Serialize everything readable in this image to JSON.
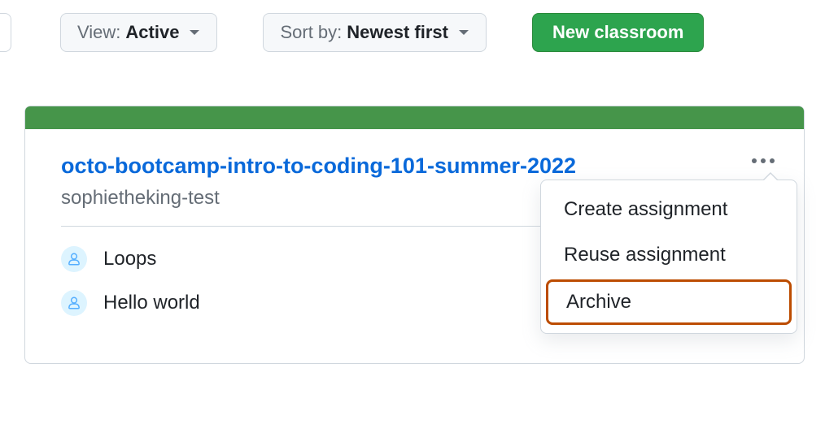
{
  "toolbar": {
    "view": {
      "prefix": "View:",
      "value": "Active"
    },
    "sort": {
      "prefix": "Sort by:",
      "value": "Newest first"
    },
    "new_classroom_label": "New classroom"
  },
  "classroom": {
    "title": "octo-bootcamp-intro-to-coding-101-summer-2022",
    "subtitle": "sophietheking-test",
    "assignments": [
      {
        "name": "Loops"
      },
      {
        "name": "Hello world"
      }
    ],
    "menu": {
      "create": "Create assignment",
      "reuse": "Reuse assignment",
      "archive": "Archive"
    }
  }
}
